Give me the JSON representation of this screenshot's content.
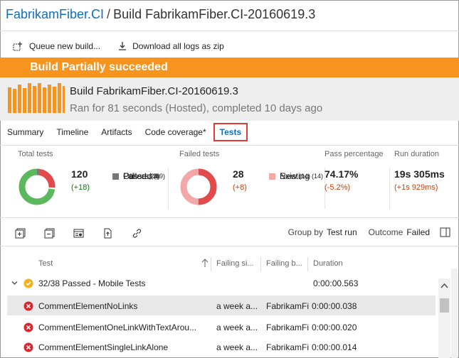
{
  "breadcrumb": {
    "pipeline": "FabrikamFiber.CI",
    "separator": "/",
    "build": "Build FabrikamFiber.CI-20160619.3"
  },
  "toolbar": {
    "queue_label": "Queue new build...",
    "download_label": "Download all logs as zip"
  },
  "banner": {
    "text": "Build Partially succeeded",
    "color": "#f7941d"
  },
  "build": {
    "title": "Build FabrikamFiber.CI-20160619.3",
    "subtitle": "Ran for 81 seconds (Hosted), completed 10 days ago"
  },
  "tabs": [
    {
      "label": "Summary"
    },
    {
      "label": "Timeline"
    },
    {
      "label": "Artifacts"
    },
    {
      "label": "Code coverage*"
    },
    {
      "label": "Tests",
      "active": true
    }
  ],
  "stats": {
    "total": {
      "label": "Total tests",
      "value": "120",
      "delta": "(+18)",
      "legend": [
        {
          "label": "Passed",
          "count": "(89)",
          "color": "#5cb85c"
        },
        {
          "label": "Failed",
          "count": "(28)",
          "color": "#e24b4b"
        },
        {
          "label": "Others",
          "count": "(3)",
          "color": "#777777"
        }
      ]
    },
    "failed": {
      "label": "Failed tests",
      "value": "28",
      "delta": "(+8)",
      "legend": [
        {
          "label": "New",
          "count": "(14)",
          "color": "#e24b4b"
        },
        {
          "label": "Existing",
          "count": "(14)",
          "color": "#f3a7a7"
        }
      ]
    },
    "pass_pct": {
      "label": "Pass percentage",
      "value": "74.17%",
      "delta": "(-5.2%)"
    },
    "duration": {
      "label": "Run duration",
      "value": "19s 305ms",
      "delta": "(+1s 929ms)"
    }
  },
  "filters": {
    "group_by_label": "Group by",
    "group_by_value": "Test run",
    "outcome_label": "Outcome",
    "outcome_value": "Failed"
  },
  "table": {
    "headers": {
      "test": "Test",
      "failing_since": "Failing si...",
      "failing_build": "Failing b...",
      "duration": "Duration"
    },
    "group": {
      "title": "32/38 Passed - Mobile Tests",
      "duration": "0:00:00.563"
    },
    "rows": [
      {
        "name": "CommentElementNoLinks",
        "since": "a week a...",
        "build": "FabrikamFi",
        "duration": "0:00:00.038",
        "selected": true
      },
      {
        "name": "CommentElementOneLinkWithTextArou...",
        "since": "a week a...",
        "build": "FabrikamFi",
        "duration": "0:00:00.020"
      },
      {
        "name": "CommentElementSingleLinkAlone",
        "since": "a week a...",
        "build": "FabrikamFi",
        "duration": "0:00:00.014"
      }
    ]
  },
  "colors": {
    "link": "#106ebe",
    "accent_orange": "#f7941d",
    "error_red": "#d9262c",
    "passed_green": "#5cb85c"
  }
}
